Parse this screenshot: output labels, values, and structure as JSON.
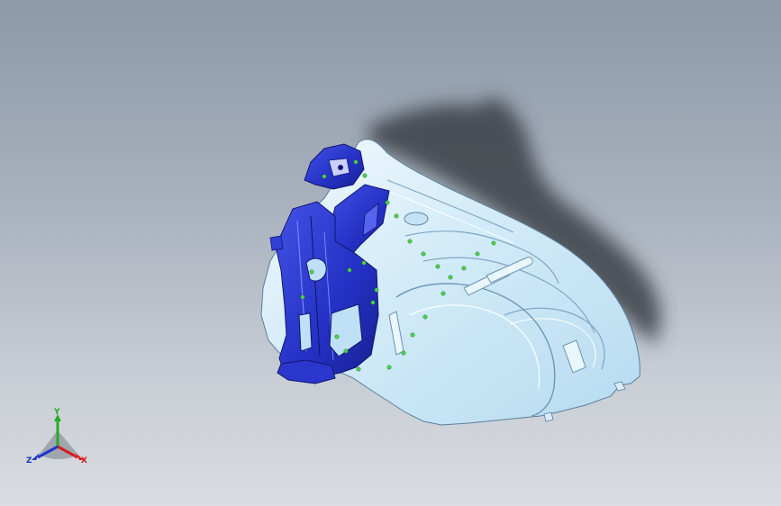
{
  "viewport": {
    "background_top": "#8d99a9",
    "background_bottom": "#d9dce0",
    "model": {
      "panel_color": "#d6ecf7",
      "bracket_color": "#2431c8",
      "weld_color": "#4fd24f",
      "shadow_color": "#3c4148"
    }
  },
  "triad": {
    "x_label": "X",
    "y_label": "Y",
    "z_label": "Z",
    "x_color": "#d81c1c",
    "y_color": "#2aa82a",
    "z_color": "#2233cc"
  }
}
